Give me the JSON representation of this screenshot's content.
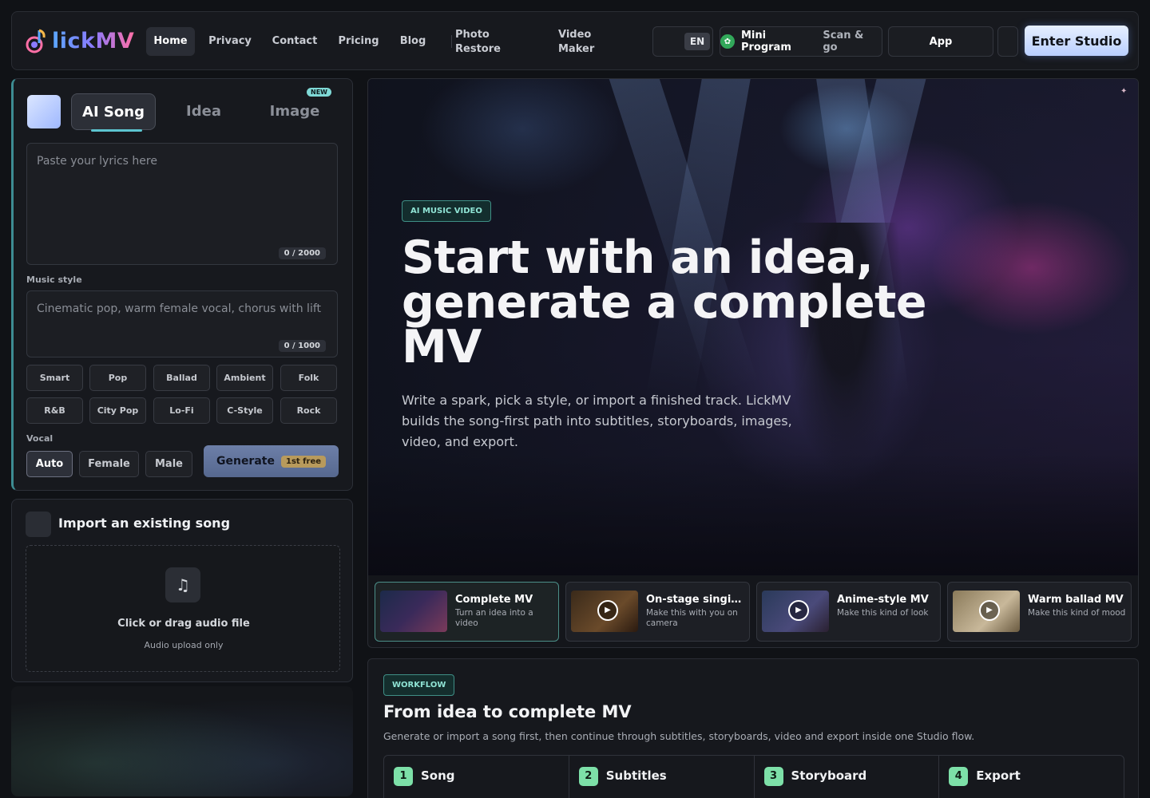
{
  "brand": {
    "logo_text": "lickMV"
  },
  "nav": {
    "links": [
      "Home",
      "Privacy",
      "Contact",
      "Pricing",
      "Blog"
    ],
    "photo_restore": [
      "Photo",
      "Restore"
    ],
    "video_maker": [
      "Video",
      "Maker"
    ],
    "lang": "EN",
    "mini_program": "Mini Program",
    "mini_program_sub": "Scan & go",
    "app": "App",
    "enter_studio": "Enter Studio"
  },
  "create": {
    "tabs": [
      "AI Song",
      "Idea",
      "Image"
    ],
    "new_badge": "NEW",
    "lyrics_placeholder": "Paste your lyrics here",
    "lyrics_counter": "0 / 2000",
    "music_style_label": "Music style",
    "style_placeholder": "Cinematic pop, warm female vocal, chorus with lift",
    "style_counter": "0 / 1000",
    "style_chips": [
      "Smart",
      "Pop",
      "Ballad",
      "Ambient",
      "Folk",
      "R&B",
      "City Pop",
      "Lo-Fi",
      "C-Style",
      "Rock"
    ],
    "vocal_label": "Vocal",
    "vocal_options": [
      "Auto",
      "Female",
      "Male"
    ],
    "generate_label": "Generate",
    "generate_badge": "1st free"
  },
  "import": {
    "title": "Import an existing song",
    "drop_title": "Click or drag audio file",
    "drop_sub": "Audio upload only"
  },
  "hero": {
    "badge": "AI MUSIC VIDEO",
    "title": "Start with an idea, generate a complete MV",
    "description": "Write a spark, pick a style, or import a finished track. LickMV builds the song-first path into subtitles, storyboards, images, video, and export."
  },
  "cards": [
    {
      "title": "Complete MV",
      "sub": "Turn an idea into a video"
    },
    {
      "title": "On-stage singing...",
      "sub": "Make this with you on camera"
    },
    {
      "title": "Anime-style MV",
      "sub": "Make this kind of look"
    },
    {
      "title": "Warm ballad MV",
      "sub": "Make this kind of mood"
    }
  ],
  "workflow": {
    "badge": "WORKFLOW",
    "title": "From idea to complete MV",
    "sub": "Generate or import a song first, then continue through subtitles, storyboards, video and export inside one Studio flow.",
    "steps": [
      {
        "num": "1",
        "name": "Song"
      },
      {
        "num": "2",
        "name": "Subtitles"
      },
      {
        "num": "3",
        "name": "Storyboard"
      },
      {
        "num": "4",
        "name": "Export"
      }
    ]
  },
  "colors": {
    "accent_teal": "#5cc4cf",
    "step_green": "#7de0a8",
    "enter_btn": "#b9cfff"
  }
}
